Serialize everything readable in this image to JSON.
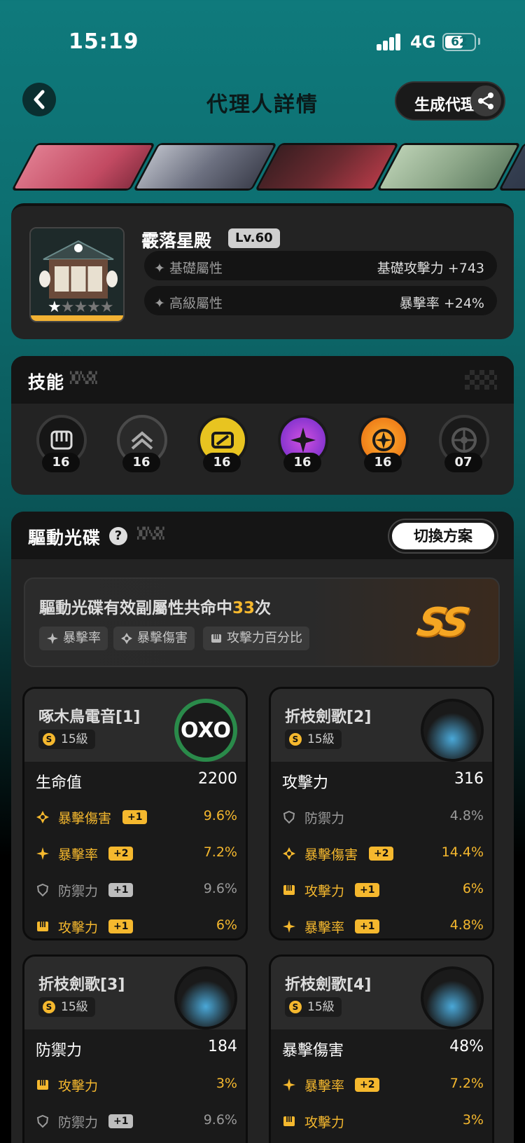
{
  "status": {
    "time": "15:19",
    "network": "4G",
    "battery": "62",
    "battery_level": 0.62
  },
  "header": {
    "title": "代理人詳情",
    "generate_label": "生成代理",
    "back_icon": "chevron-left-icon",
    "share_icon": "share-icon"
  },
  "characters": [
    {
      "name": "character-1",
      "color": "#d46a7e"
    },
    {
      "name": "character-2",
      "color": "#7a7f8e"
    },
    {
      "name": "character-3",
      "color": "#4a2a2e"
    },
    {
      "name": "character-4",
      "color": "#8ea88a"
    },
    {
      "name": "character-5",
      "color": "#2c3545"
    }
  ],
  "engine": {
    "name": "霰落星殿",
    "level": "Lv.60",
    "base_label": "基礎屬性",
    "base_value": "基礎攻擊力 +743",
    "adv_label": "高級屬性",
    "adv_value": "暴擊率 +24%",
    "stars_filled": 1,
    "stars_total": 5
  },
  "skills": {
    "title": "技能",
    "items": [
      {
        "name": "basic-attack-icon",
        "level": "16",
        "color": "#3a3a3a"
      },
      {
        "name": "dodge-icon",
        "level": "16",
        "color": "#4a4a4a"
      },
      {
        "name": "assist-icon",
        "level": "16",
        "color": "#e8c420"
      },
      {
        "name": "special-attack-icon",
        "level": "16",
        "color": "#9a3ad8"
      },
      {
        "name": "chain-attack-icon",
        "level": "16",
        "color": "#f08a1a"
      },
      {
        "name": "core-skill-icon",
        "level": "07",
        "color": "#2a2a2a"
      }
    ]
  },
  "discs": {
    "title": "驅動光碟",
    "switch_label": "切換方案",
    "summary_prefix": "驅動光碟有效副屬性共命中",
    "summary_count": "33",
    "summary_suffix": "次",
    "tags": [
      "暴擊率",
      "暴擊傷害",
      "攻擊力百分比"
    ],
    "rank": "SS",
    "items": [
      {
        "name": "啄木鳥電音[1]",
        "level": "15級",
        "logo": "OXO",
        "main_name": "生命值",
        "main_value": "2200",
        "subs": [
          {
            "name": "暴擊傷害",
            "roll": "+1",
            "value": "9.6%",
            "active": true,
            "icon": "crit-dmg-icon"
          },
          {
            "name": "暴擊率",
            "roll": "+2",
            "value": "7.2%",
            "active": true,
            "icon": "crit-rate-icon"
          },
          {
            "name": "防禦力",
            "roll": "+1",
            "value": "9.6%",
            "active": false,
            "icon": "defense-icon"
          },
          {
            "name": "攻擊力",
            "roll": "+1",
            "value": "6%",
            "active": true,
            "icon": "attack-icon"
          }
        ]
      },
      {
        "name": "折枝劍歌[2]",
        "level": "15級",
        "logo": "",
        "main_name": "攻擊力",
        "main_value": "316",
        "subs": [
          {
            "name": "防禦力",
            "roll": "",
            "value": "4.8%",
            "active": false,
            "icon": "defense-icon"
          },
          {
            "name": "暴擊傷害",
            "roll": "+2",
            "value": "14.4%",
            "active": true,
            "icon": "crit-dmg-icon"
          },
          {
            "name": "攻擊力",
            "roll": "+1",
            "value": "6%",
            "active": true,
            "icon": "attack-icon"
          },
          {
            "name": "暴擊率",
            "roll": "+1",
            "value": "4.8%",
            "active": true,
            "icon": "crit-rate-icon"
          }
        ]
      },
      {
        "name": "折枝劍歌[3]",
        "level": "15級",
        "logo": "",
        "main_name": "防禦力",
        "main_value": "184",
        "subs": [
          {
            "name": "攻擊力",
            "roll": "",
            "value": "3%",
            "active": true,
            "icon": "attack-icon"
          },
          {
            "name": "防禦力",
            "roll": "+1",
            "value": "9.6%",
            "active": false,
            "icon": "defense-icon"
          }
        ]
      },
      {
        "name": "折枝劍歌[4]",
        "level": "15級",
        "logo": "",
        "main_name": "暴擊傷害",
        "main_value": "48%",
        "subs": [
          {
            "name": "暴擊率",
            "roll": "+2",
            "value": "7.2%",
            "active": true,
            "icon": "crit-rate-icon"
          },
          {
            "name": "攻擊力",
            "roll": "",
            "value": "3%",
            "active": true,
            "icon": "attack-icon"
          }
        ]
      }
    ]
  }
}
